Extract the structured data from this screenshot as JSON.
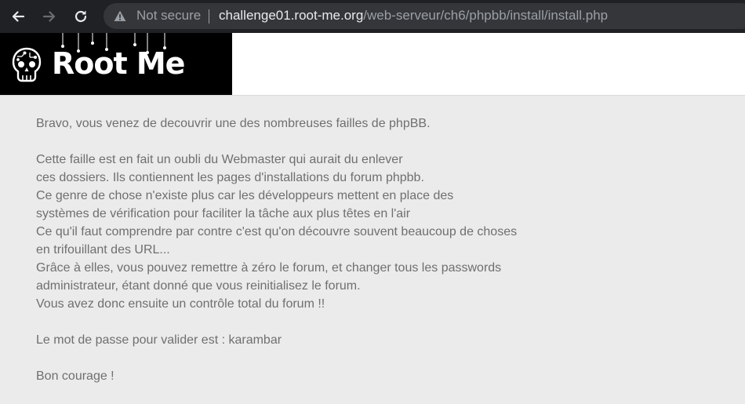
{
  "browser": {
    "security_label": "Not secure",
    "url_host": "challenge01.root-me.org",
    "url_path": "/web-serveur/ch6/phpbb/install/install.php",
    "icons": [
      "back-arrow-icon",
      "forward-arrow-icon",
      "reload-icon",
      "warning-icon"
    ]
  },
  "header": {
    "logo_text": "Root Me",
    "logo_background": "#000000"
  },
  "content": {
    "intro": "Bravo, vous venez de decouvrir une des nombreuses failles de phpBB.",
    "lines": [
      "Cette faille est en fait un oubli du Webmaster qui aurait du enlever",
      "ces dossiers. Ils contiennent les pages d'installations du forum phpbb.",
      "Ce genre de chose n'existe plus car les développeurs mettent en place des",
      "systèmes de vérification pour faciliter la tâche aux plus têtes en l'air",
      "Ce qu'il faut comprendre par contre c'est qu'on découvre souvent beaucoup de choses",
      "en trifouillant des URL...",
      "Grâce à elles, vous pouvez remettre à zéro le forum, et changer tous les passwords",
      "administrateur, étant donné que vous reinitialisez le forum.",
      "Vous avez donc ensuite un contrôle total du forum !!"
    ],
    "password_line": "Le mot de passe pour valider est : karambar",
    "closing": "Bon courage !"
  },
  "colors": {
    "chrome_bg": "#202124",
    "omnibox_bg": "#35363a",
    "page_bg": "#ebebeb",
    "text": "#6f6f6f"
  }
}
